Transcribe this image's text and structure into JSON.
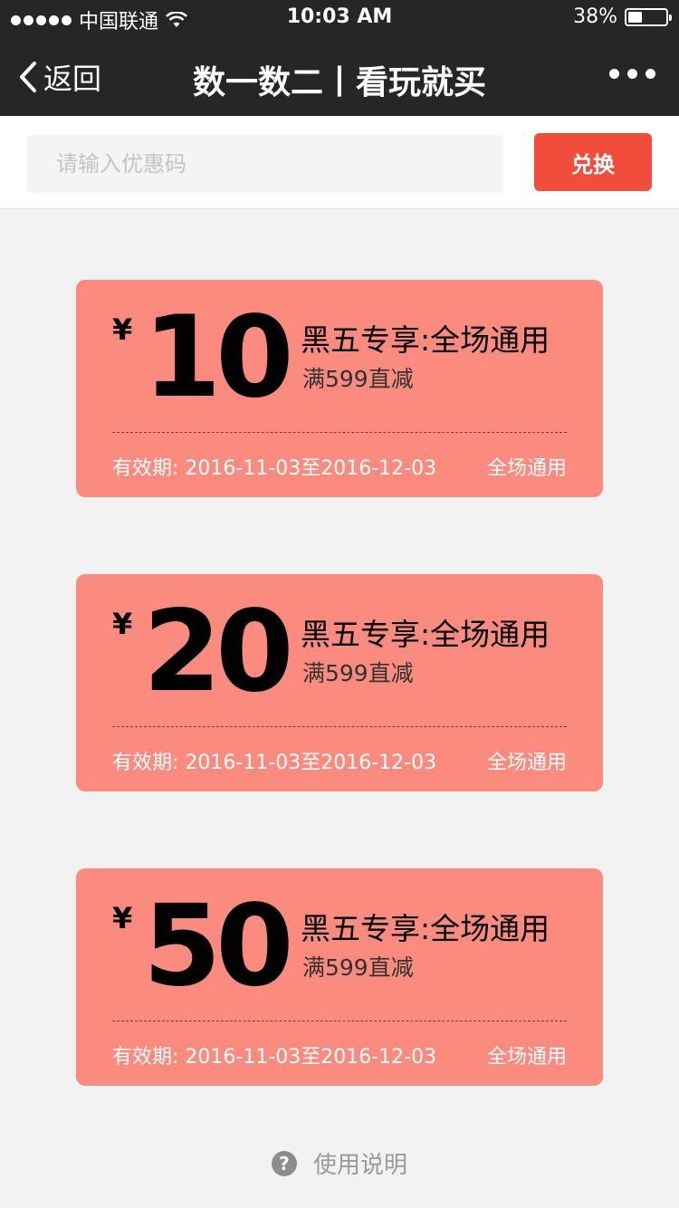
{
  "status_bar": {
    "carrier": "中国联通",
    "time": "10:03 AM",
    "battery_percent": "38%",
    "battery_level": 0.38,
    "icons": [
      "signal-dots-icon",
      "wifi-icon",
      "battery-icon"
    ]
  },
  "nav": {
    "back_label": "返回",
    "title": "数一数二丨看玩就买",
    "icons": [
      "chevron-left-icon",
      "more-dots-icon"
    ]
  },
  "redeem": {
    "placeholder": "请输入优惠码",
    "button_label": "兑换"
  },
  "coupons": [
    {
      "currency": "¥",
      "amount": "10",
      "title": "黑五专享:全场通用",
      "condition": "满599直减",
      "validity": "有效期: 2016-11-03至2016-12-03",
      "scope": "全场通用"
    },
    {
      "currency": "¥",
      "amount": "20",
      "title": "黑五专享:全场通用",
      "condition": "满599直减",
      "validity": "有效期: 2016-11-03至2016-12-03",
      "scope": "全场通用"
    },
    {
      "currency": "¥",
      "amount": "50",
      "title": "黑五专享:全场通用",
      "condition": "满599直减",
      "validity": "有效期: 2016-11-03至2016-12-03",
      "scope": "全场通用"
    }
  ],
  "help": {
    "icon": "question-circle-icon",
    "label": "使用说明"
  },
  "colors": {
    "header_bg": "#262626",
    "accent_button": "#f24c3d",
    "coupon_bg": "#fb8b7f",
    "page_bg": "#f2f2f2"
  }
}
